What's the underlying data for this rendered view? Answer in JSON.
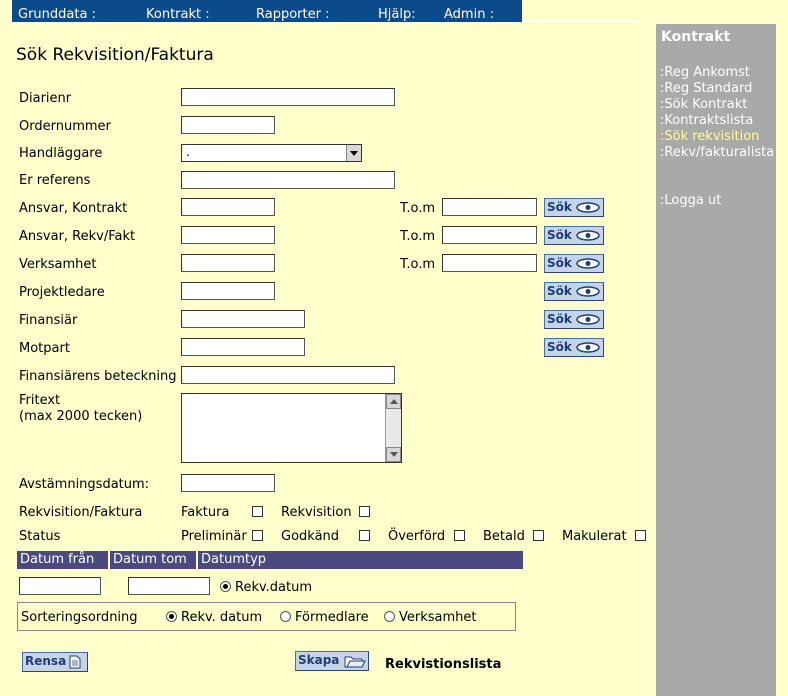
{
  "menu": {
    "items": [
      "Grunddata :",
      "Kontrakt :",
      "Rapporter :",
      "Hjälp:",
      "Admin :"
    ]
  },
  "sidebar": {
    "title": "Kontrakt",
    "links": [
      ":Reg Ankomst",
      ":Reg Standard",
      ":Sök Kontrakt",
      ":Kontraktslista",
      ":Sök rekvisition",
      ":Rekv/fakturalista"
    ],
    "logout": ":Logga ut"
  },
  "page": {
    "title": "Sök Rekvisition/Faktura"
  },
  "form": {
    "diarienr": "Diarienr",
    "ordernummer": "Ordernummer",
    "handlaggare": "Handläggare",
    "handlaggare_value": ".",
    "er_referens": "Er referens",
    "ansvar_kontrakt": "Ansvar, Kontrakt",
    "ansvar_rekv": "Ansvar, Rekv/Fakt",
    "verksamhet": "Verksamhet",
    "projektledare": "Projektledare",
    "finansiar": "Finansiär",
    "motpart": "Motpart",
    "finansiarens_beteckning": "Finansiärens beteckning",
    "fritext": "Fritext",
    "fritext_hint": "(max 2000 tecken)",
    "avstamningsdatum": "Avstämningsdatum:",
    "tom": "T.o.m",
    "sok": "Sök",
    "rekv_faktura": "Rekvisition/Faktura",
    "faktura": "Faktura",
    "rekvisition": "Rekvisition",
    "status": "Status",
    "status_options": [
      "Preliminär",
      "Godkänd",
      "Överförd",
      "Betald",
      "Makulerat"
    ]
  },
  "dates": {
    "from": "Datum från",
    "to": "Datum tom",
    "type": "Datumtyp",
    "type_option": "Rekv.datum"
  },
  "sort": {
    "label": "Sorteringsordning",
    "options": [
      "Rekv. datum",
      "Förmedlare",
      "Verksamhet"
    ]
  },
  "buttons": {
    "rensa": "Rensa",
    "skapa": "Skapa",
    "rekvistionslista": "Rekvistionslista"
  },
  "colors": {
    "background": "#ffffcc",
    "menubar": "#0b4a8b",
    "sidebar": "#a9a9a9",
    "datebar": "#4a4a80",
    "button": "#c6d4e8"
  }
}
